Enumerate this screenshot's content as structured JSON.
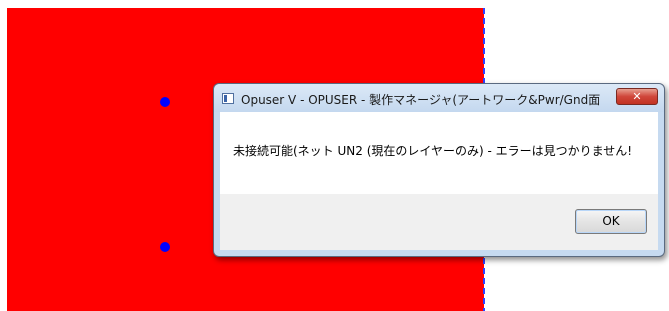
{
  "background": {
    "fill_color": "#ff0000",
    "dot_color": "#0000ff",
    "edge_color": "#3040ff"
  },
  "dialog": {
    "title": "Opuser V - OPUSER - 製作マネージャ(アートワーク&Pwr/Gnd面(...",
    "close_label": "✕",
    "message": "未接続可能(ネット UN2 (現在のレイヤーのみ) - エラーは見つかりません!",
    "ok_label": "OK",
    "icon": "app-window-icon"
  }
}
